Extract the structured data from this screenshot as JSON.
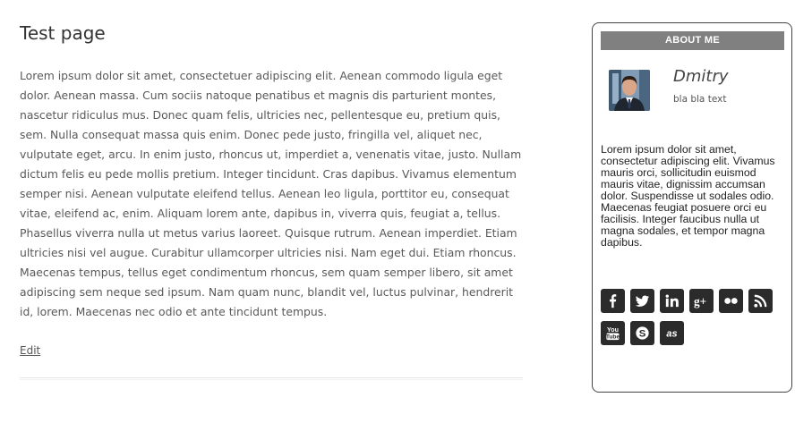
{
  "page": {
    "title": "Test page",
    "body": "Lorem ipsum dolor sit amet, consectetuer adipiscing elit. Aenean commodo ligula eget dolor. Aenean massa. Cum sociis natoque penatibus et magnis dis parturient montes, nascetur ridiculus mus. Donec quam felis, ultricies nec, pellentesque eu, pretium quis, sem. Nulla consequat massa quis enim. Donec pede justo, fringilla vel, aliquet nec, vulputate eget, arcu. In enim justo, rhoncus ut, imperdiet a, venenatis vitae, justo. Nullam dictum felis eu pede mollis pretium. Integer tincidunt. Cras dapibus. Vivamus elementum semper nisi. Aenean vulputate eleifend tellus. Aenean leo ligula, porttitor eu, consequat vitae, eleifend ac, enim. Aliquam lorem ante, dapibus in, viverra quis, feugiat a, tellus. Phasellus viverra nulla ut metus varius laoreet. Quisque rutrum. Aenean imperdiet. Etiam ultricies nisi vel augue. Curabitur ullamcorper ultricies nisi. Nam eget dui. Etiam rhoncus. Maecenas tempus, tellus eget condimentum rhoncus, sem quam semper libero, sit amet adipiscing sem neque sed ipsum. Nam quam nunc, blandit vel, luctus pulvinar, hendrerit id, lorem. Maecenas nec odio et ante tincidunt tempus.",
    "edit_label": "Edit"
  },
  "sidebar": {
    "title": "ABOUT ME",
    "name": "Dmitry",
    "subtitle": "bla bla text",
    "about": "Lorem ipsum dolor sit amet, consectetur adipiscing elit. Vivamus mauris orci, sollicitudin euismod mauris vitae, dignissim accumsan dolor. Suspendisse ut sodales odio. Maecenas feugiat posuere orci eu facilisis. Integer faucibus nulla ut magna sodales, et tempor magna dapibus.",
    "socials": [
      {
        "icon": "facebook-icon"
      },
      {
        "icon": "twitter-icon"
      },
      {
        "icon": "linkedin-icon"
      },
      {
        "icon": "google-plus-icon"
      },
      {
        "icon": "flickr-icon"
      },
      {
        "icon": "rss-icon"
      },
      {
        "icon": "youtube-icon",
        "label": "You Tube"
      },
      {
        "icon": "skype-icon"
      },
      {
        "icon": "lastfm-icon"
      }
    ]
  },
  "colors": {
    "widget_header": "#808080",
    "social_bg": "#2b2b2b"
  }
}
